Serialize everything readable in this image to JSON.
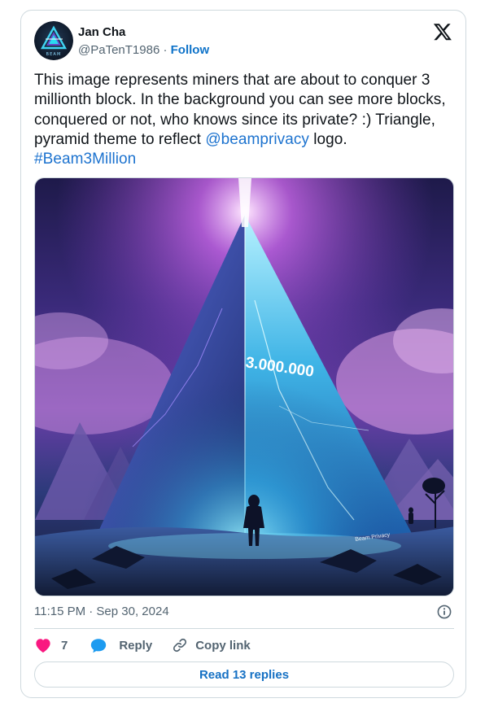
{
  "author": {
    "name": "Jan Cha",
    "handle": "@PaTenT1986",
    "separator": "·",
    "follow_label": "Follow",
    "avatar_text": "BEAM"
  },
  "tweet": {
    "text_plain": "This image represents miners that are about to conquer 3 millionth block. In the background you can see more blocks, conquered or not, who knows since its private? :) Triangle, pyramid theme to reflect ",
    "mention": "@beamprivacy",
    "text_after_mention": " logo.",
    "hashtag": "#Beam3Million"
  },
  "media": {
    "label_number": "3.000.000",
    "watermark": "Beam Privacy"
  },
  "timestamp": "11:15 PM · Sep 30, 2024",
  "actions": {
    "like_count": "7",
    "reply_label": "Reply",
    "copy_link_label": "Copy link"
  },
  "read_replies_label": "Read 13 replies",
  "colors": {
    "link": "#1d73cf",
    "like": "#f91880",
    "reply_bubble": "#1d9bf0",
    "muted": "#536471"
  },
  "icons": [
    "x-logo-icon",
    "info-icon",
    "heart-icon",
    "reply-bubble-icon",
    "link-icon"
  ]
}
